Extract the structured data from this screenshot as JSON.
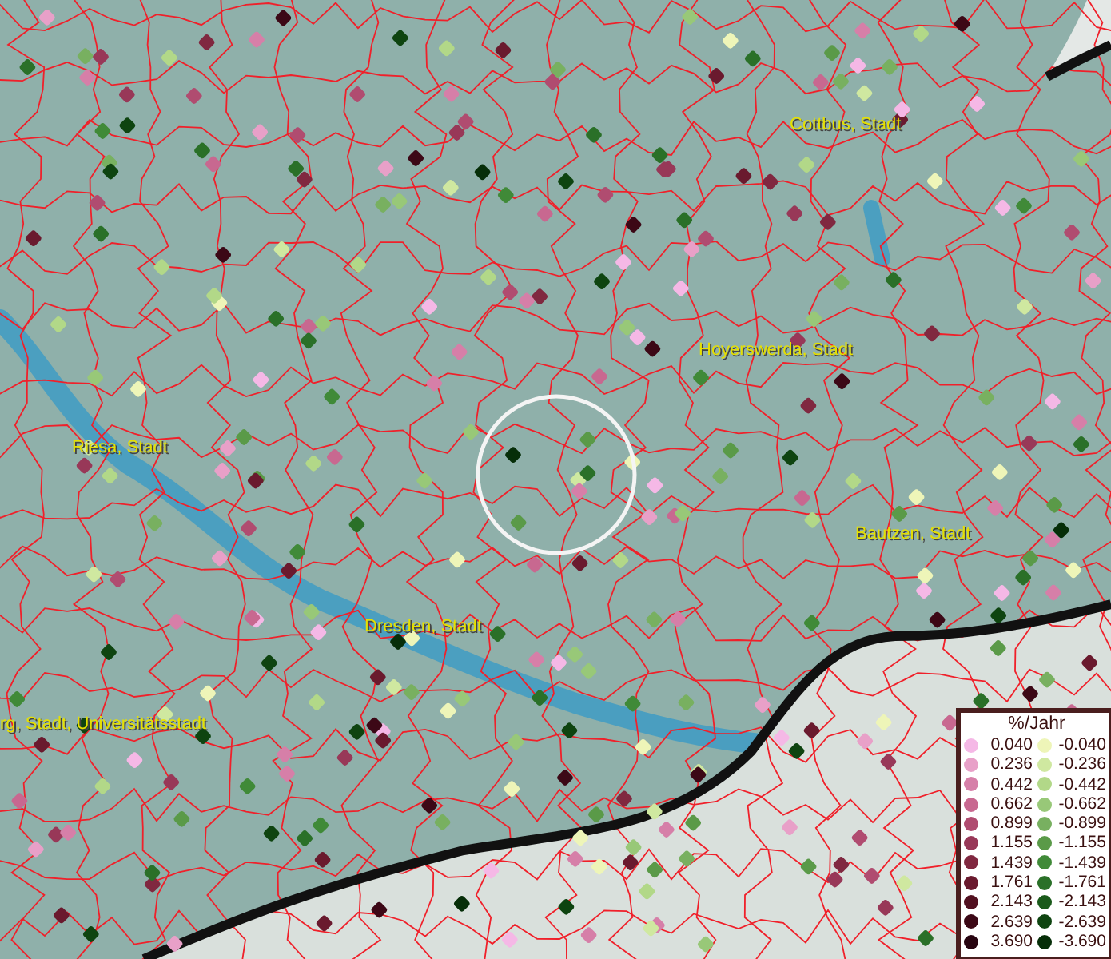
{
  "map": {
    "place_labels": [
      {
        "name": "Cottbus, Stadt"
      },
      {
        "name": "Hoyerswerda, Stadt"
      },
      {
        "name": "Riesa, Stadt"
      },
      {
        "name": "Bautzen, Stadt"
      },
      {
        "name": "Dresden, Stadt"
      },
      {
        "name": "rg, Stadt, Universitätsstadt"
      }
    ]
  },
  "legend": {
    "title": "%/Jahr",
    "rows": [
      {
        "positive": {
          "value": "0.040",
          "color": "#f5b8e6"
        },
        "negative": {
          "value": "-0.040",
          "color": "#eef5b8"
        }
      },
      {
        "positive": {
          "value": "0.236",
          "color": "#e8a0c8"
        },
        "negative": {
          "value": "-0.236",
          "color": "#cfe8a0"
        }
      },
      {
        "positive": {
          "value": "0.442",
          "color": "#d67fa8"
        },
        "negative": {
          "value": "-0.442",
          "color": "#b2d888"
        }
      },
      {
        "positive": {
          "value": "0.662",
          "color": "#c86890"
        },
        "negative": {
          "value": "-0.662",
          "color": "#98c878"
        }
      },
      {
        "positive": {
          "value": "0.899",
          "color": "#b04c70"
        },
        "negative": {
          "value": "-0.899",
          "color": "#78b060"
        }
      },
      {
        "positive": {
          "value": "1.155",
          "color": "#983858"
        },
        "negative": {
          "value": "-1.155",
          "color": "#5a9a48"
        }
      },
      {
        "positive": {
          "value": "1.439",
          "color": "#802840"
        },
        "negative": {
          "value": "-1.439",
          "color": "#408a38"
        }
      },
      {
        "positive": {
          "value": "1.761",
          "color": "#6a1a2e"
        },
        "negative": {
          "value": "-1.761",
          "color": "#2a7028"
        }
      },
      {
        "positive": {
          "value": "2.143",
          "color": "#521020"
        },
        "negative": {
          "value": "-2.143",
          "color": "#1a5a1a"
        }
      },
      {
        "positive": {
          "value": "2.639",
          "color": "#3c0816"
        },
        "negative": {
          "value": "-2.639",
          "color": "#0e4410"
        }
      },
      {
        "positive": {
          "value": "3.690",
          "color": "#280410"
        },
        "negative": {
          "value": "-3.690",
          "color": "#062e08"
        }
      }
    ]
  }
}
